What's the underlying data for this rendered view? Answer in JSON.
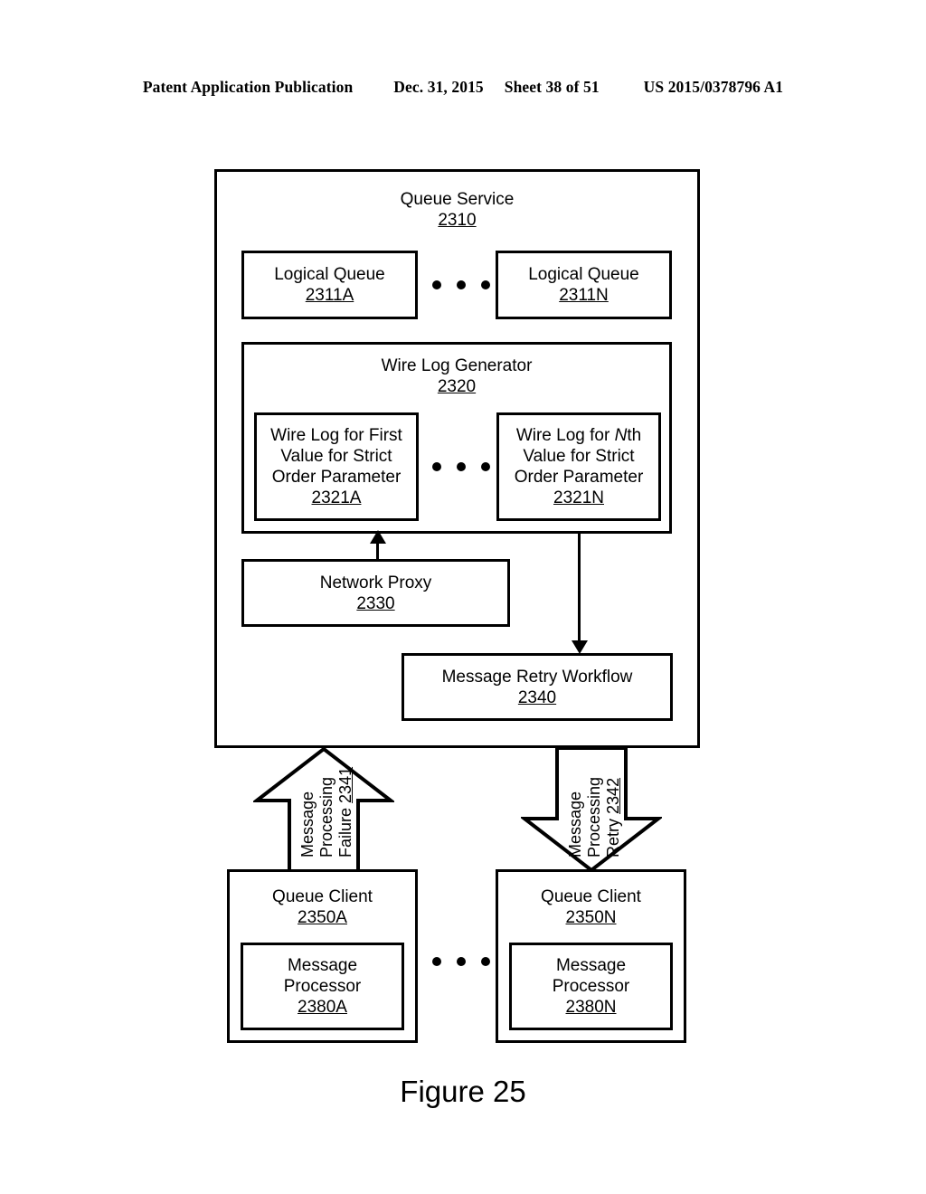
{
  "header": {
    "publication": "Patent Application Publication",
    "date": "Dec. 31, 2015",
    "sheet": "Sheet 38 of 51",
    "patent_number": "US 2015/0378796 A1"
  },
  "figure": {
    "caption": "Figure 25"
  },
  "diagram": {
    "queue_service": {
      "label": "Queue Service",
      "ref": "2310"
    },
    "logical_queues": [
      {
        "label": "Logical Queue",
        "ref": "2311A"
      },
      {
        "label": "Logical Queue",
        "ref": "2311N"
      }
    ],
    "wire_log_generator": {
      "label": "Wire Log Generator",
      "ref": "2320"
    },
    "wire_logs": [
      {
        "line1": "Wire Log for First",
        "line2": "Value for Strict",
        "line3": "Order Parameter",
        "ref": "2321A"
      },
      {
        "line1_prefix": "Wire Log for ",
        "line1_italic": "N",
        "line1_suffix": "th",
        "line2": "Value for Strict",
        "line3": "Order Parameter",
        "ref": "2321N"
      }
    ],
    "network_proxy": {
      "label": "Network Proxy",
      "ref": "2330"
    },
    "message_retry_workflow": {
      "label": "Message Retry Workflow",
      "ref": "2340"
    },
    "arrows": {
      "failure": {
        "line1": "Message",
        "line2": "Processing",
        "line3": "Failure",
        "ref": "2341",
        "direction": "up"
      },
      "retry": {
        "line1": "Message",
        "line2": "Processing",
        "line3": "Retry",
        "ref": "2342",
        "direction": "down"
      }
    },
    "queue_clients": [
      {
        "label": "Queue Client",
        "ref": "2350A",
        "processor": {
          "line1": "Message",
          "line2": "Processor",
          "ref": "2380A"
        }
      },
      {
        "label": "Queue Client",
        "ref": "2350N",
        "processor": {
          "line1": "Message",
          "line2": "Processor",
          "ref": "2380N"
        }
      }
    ],
    "ellipsis_glyph": "• • •"
  }
}
